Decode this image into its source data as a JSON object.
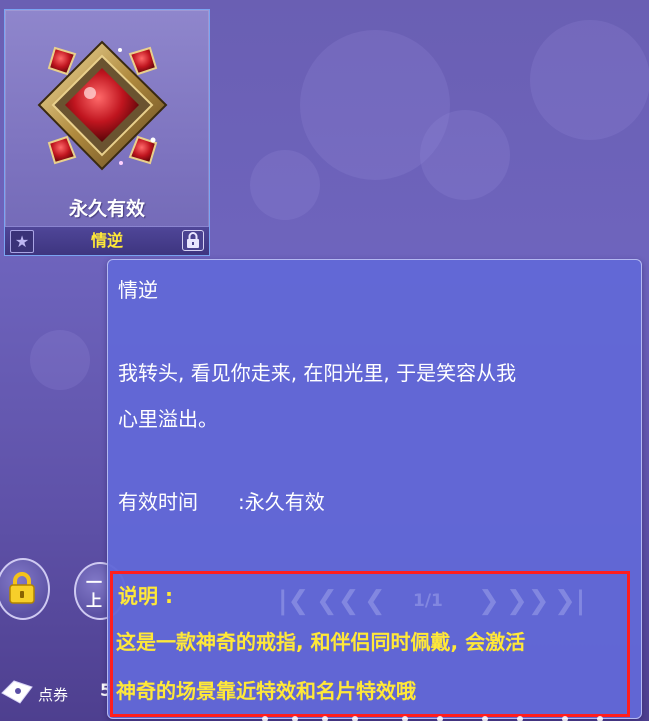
{
  "item": {
    "expiry": "永久有效",
    "name": "情逆",
    "star_icon": "star-icon",
    "lock_icon": "lock-icon"
  },
  "tooltip": {
    "title": "情逆",
    "description_line1": "我转头, 看见你走来, 在阳光里, 于是笑容从我",
    "description_line2": "心里溢出。",
    "validity_label": "有效时间",
    "validity_value": ":永久有效",
    "pager": {
      "page": "1/1",
      "first_icon": "first-page-icon",
      "prev_fast_icon": "fast-back-icon",
      "prev_icon": "prev-icon",
      "next_icon": "next-icon",
      "next_fast_icon": "fast-forward-icon",
      "last_icon": "last-page-icon"
    },
    "note_label": "说明 :",
    "note_line1": "这是一款神奇的戒指, 和伴侣同时佩戴, 会激活",
    "note_line2": "神奇的场景靠近特效和名片特效哦"
  },
  "side": {
    "round_two_text_top": "一",
    "round_two_text_bottom": "上",
    "coupon_label": "点券",
    "coupon_count": "5"
  },
  "colors": {
    "background": "#6a5fb3",
    "tooltip_bg": "#6268d6",
    "highlight_text": "#ffe838",
    "annotation_box": "#ff1e1e",
    "card_border": "#7aa4f2"
  }
}
